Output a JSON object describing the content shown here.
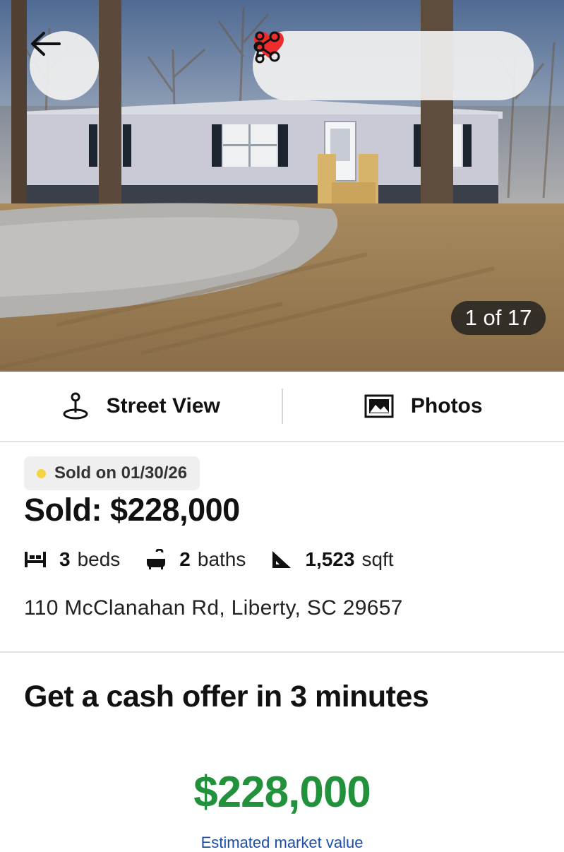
{
  "gallery": {
    "counter": "1 of 17",
    "favorite_color": "#ee2c2c"
  },
  "toolbar": {
    "back_icon": "arrow-left-icon",
    "edit_icon": "pencil-icon",
    "favorite_icon": "heart-icon",
    "share_icon": "share-icon",
    "more_icon": "more-vertical-icon"
  },
  "view_options": {
    "street_view_label": "Street View",
    "photos_label": "Photos"
  },
  "listing": {
    "status": "Sold on 01/30/26",
    "status_dot_color": "#f6d343",
    "price_line": "Sold: $228,000",
    "beds_count": "3",
    "beds_label": "beds",
    "baths_count": "2",
    "baths_label": "baths",
    "sqft_count": "1,523",
    "sqft_label": "sqft",
    "address": "110 McClanahan Rd, Liberty, SC 29657"
  },
  "cash_offer": {
    "title": "Get a cash offer in 3 minutes",
    "estimate": "$228,000",
    "estimate_color": "#22913b",
    "estimate_label": "Estimated market value"
  }
}
